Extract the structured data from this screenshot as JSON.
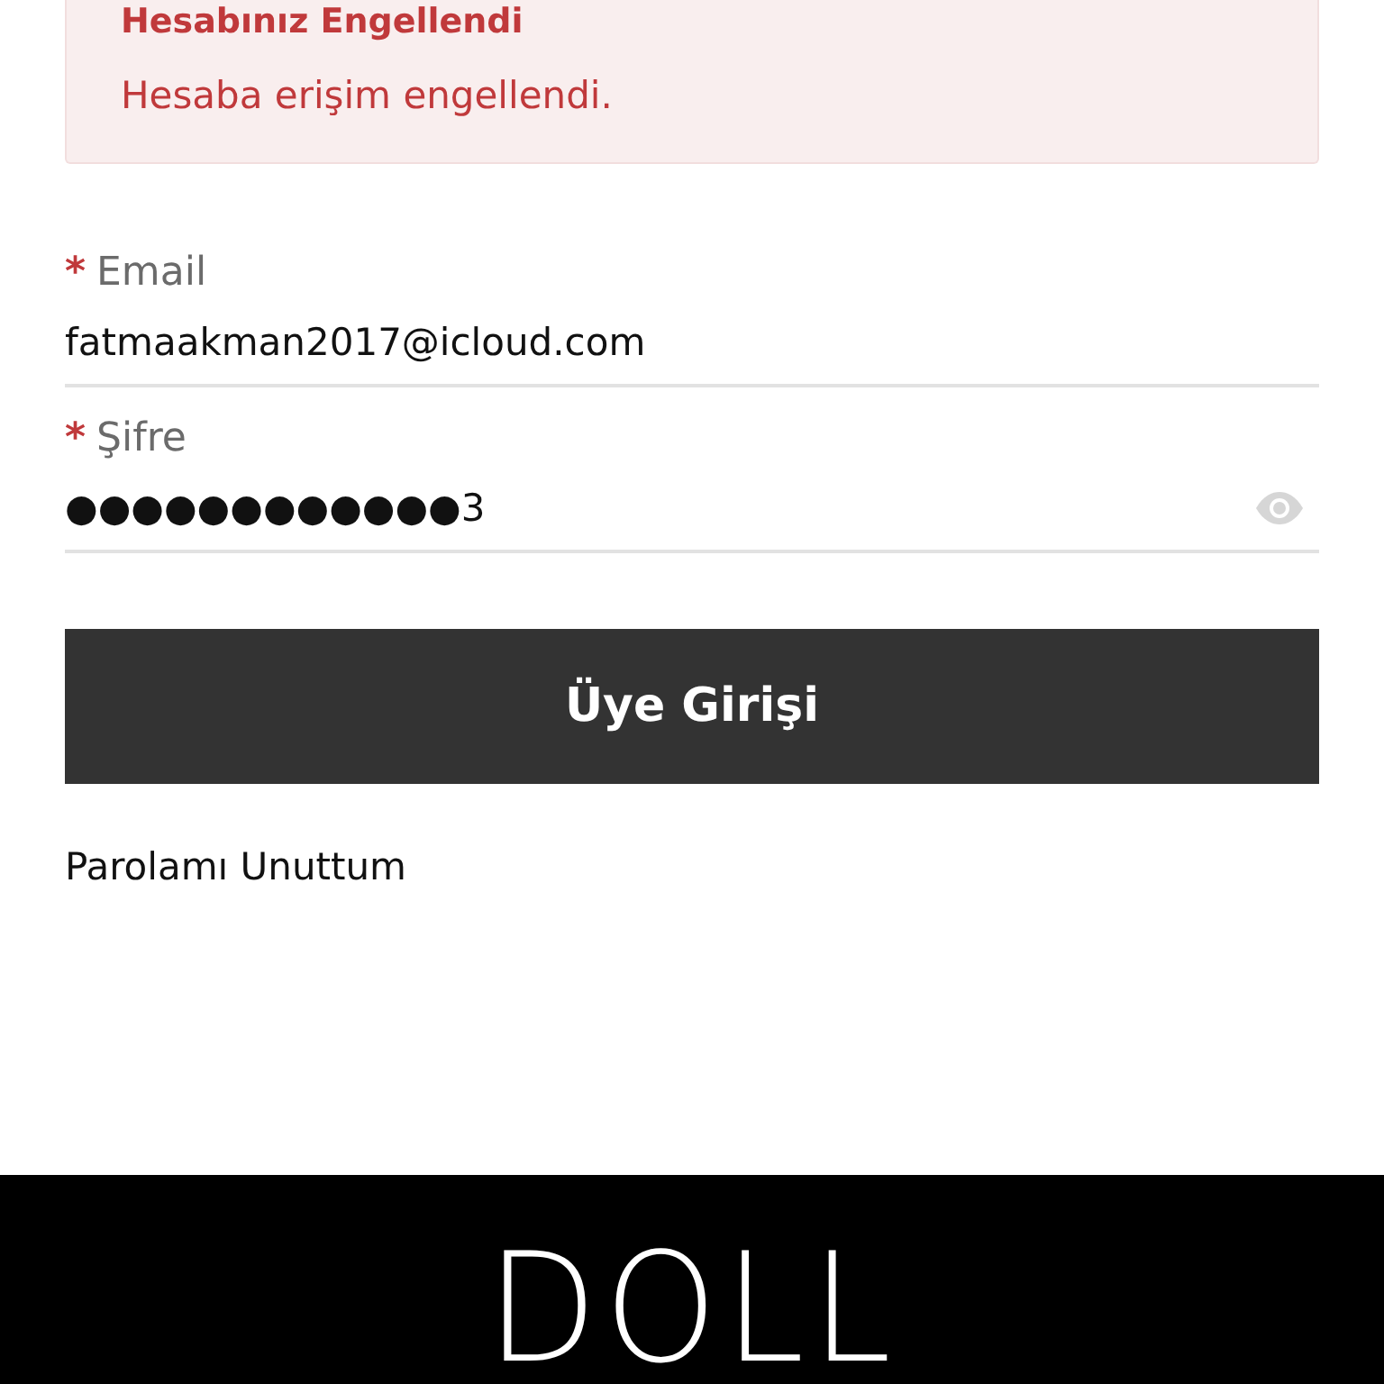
{
  "alert": {
    "title": "Hesabınız Engellendi",
    "message": "Hesaba erişim engellendi."
  },
  "fields": [
    {
      "label": "Email",
      "required_mark": "*",
      "value": "fatmaakman2017@icloud.com",
      "kind": "text"
    },
    {
      "label": "Şifre",
      "required_mark": "*",
      "value": "●●●●●●●●●●●●3",
      "kind": "password"
    }
  ],
  "submit_button": "Üye Girişi",
  "forgot_link": "Parolamı Unuttum",
  "footer": {
    "logo": "DOLL"
  }
}
